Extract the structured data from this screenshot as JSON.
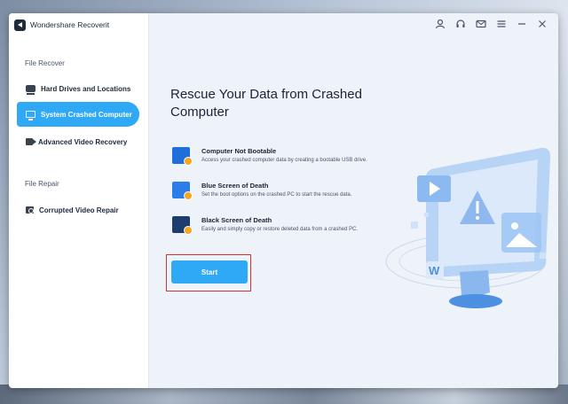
{
  "app": {
    "title": "Wondershare Recoverit"
  },
  "sidebar": {
    "sections": [
      {
        "label": "File Recover",
        "items": [
          {
            "label": "Hard Drives and Locations",
            "icon": "drive-icon",
            "active": false
          },
          {
            "label": "System Crashed Computer",
            "icon": "monitor-icon",
            "active": true
          },
          {
            "label": "Advanced Video Recovery",
            "icon": "video-icon",
            "active": false
          }
        ]
      },
      {
        "label": "File Repair",
        "items": [
          {
            "label": "Corrupted Video Repair",
            "icon": "repair-icon",
            "active": false
          }
        ]
      }
    ]
  },
  "topbar": {
    "icons": [
      "user-icon",
      "headset-icon",
      "mail-icon",
      "menu-icon",
      "minimize-icon",
      "close-icon"
    ]
  },
  "main": {
    "title": "Rescue Your Data from Crashed Computer",
    "features": [
      {
        "title": "Computer Not Bootable",
        "desc": "Access your crashed computer data by creating a bootable USB drive.",
        "color": "#1e6fd9"
      },
      {
        "title": "Blue Screen of Death",
        "desc": "Set the boot options on the crashed PC to start the rescue data.",
        "color": "#2b7de9"
      },
      {
        "title": "Black Screen of Death",
        "desc": "Easily and simply copy or restore deleted data from a crashed PC.",
        "color": "#1c3d6e"
      }
    ],
    "start_label": "Start"
  },
  "colors": {
    "accent": "#2fa8f5",
    "highlight": "#d63236"
  }
}
